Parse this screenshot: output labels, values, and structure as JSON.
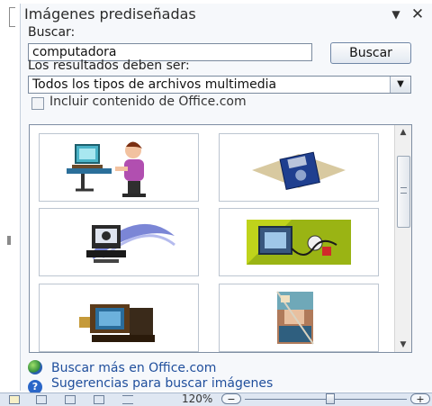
{
  "pane": {
    "title": "Imágenes prediseñadas",
    "search_label": "Buscar:",
    "search_value": "computadora",
    "search_button": "Buscar",
    "results_label": "Los resultados deben ser:",
    "media_type_selected": "Todos los tipos de archivos multimedia",
    "include_office_label": "Incluir contenido de Office.com",
    "include_office_checked": false
  },
  "results": {
    "items": [
      {
        "icon": "person-at-computer-clipart"
      },
      {
        "icon": "floppy-disk-clipart"
      },
      {
        "icon": "computer-with-signal-clipart"
      },
      {
        "icon": "monitor-mouse-clipart"
      },
      {
        "icon": "old-computer-clipart"
      },
      {
        "icon": "computer-collage-photo"
      }
    ]
  },
  "links": {
    "more_office": "Buscar más en Office.com",
    "tips": "Sugerencias para buscar imágenes"
  },
  "statusbar": {
    "zoom": "120%",
    "zoom_percent": 120
  },
  "colors": {
    "link": "#1f4e9c",
    "pane_bg": "#f6f8fb"
  }
}
